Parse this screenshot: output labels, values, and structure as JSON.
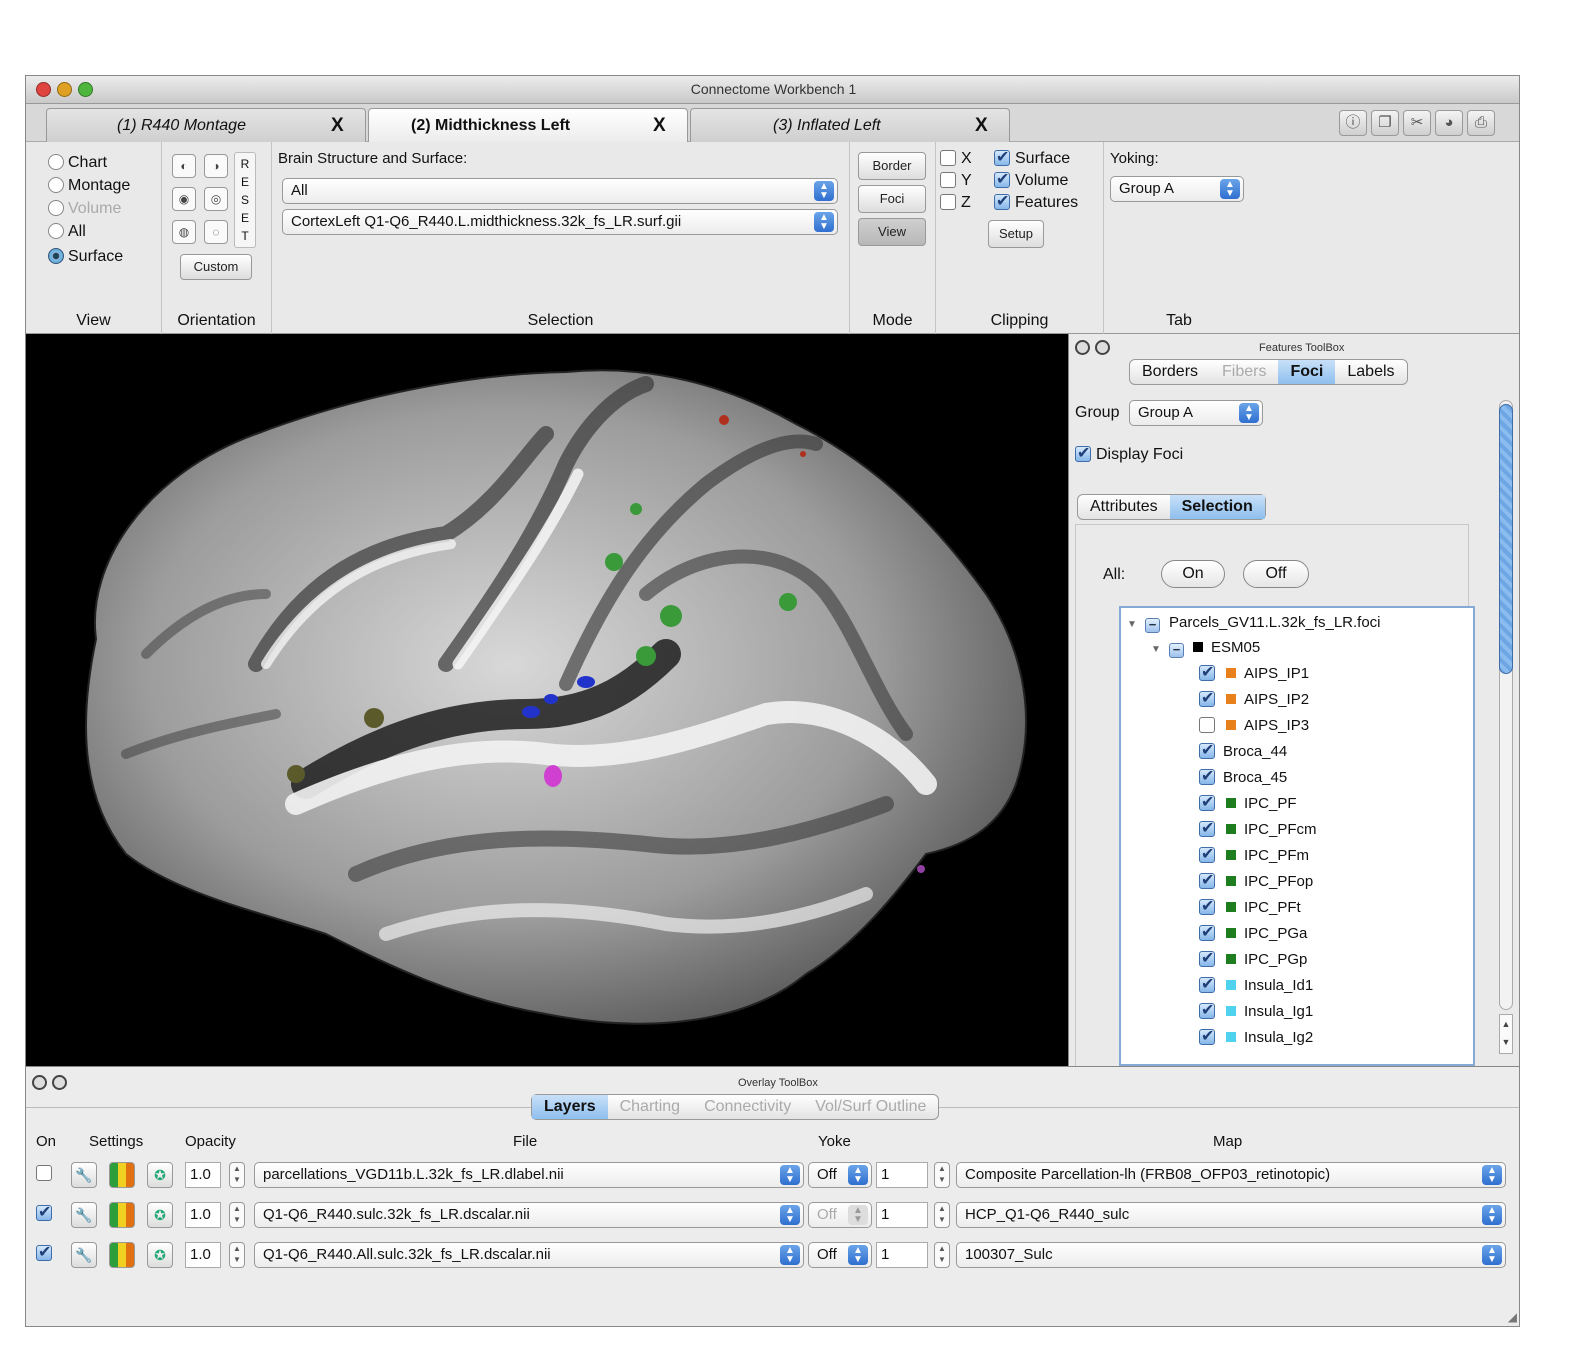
{
  "window": {
    "title": "Connectome Workbench 1"
  },
  "tabs": [
    {
      "label": "(1) R440 Montage",
      "close": "X"
    },
    {
      "label": "(2) Midthickness Left",
      "close": "X"
    },
    {
      "label": "(3) Inflated Left",
      "close": "X"
    }
  ],
  "ribbon": {
    "view": {
      "label": "View",
      "options": [
        "Chart",
        "Montage",
        "Volume",
        "All",
        "Surface"
      ],
      "selected": "Surface"
    },
    "orientation": {
      "label": "Orientation",
      "reset_letters": [
        "R",
        "E",
        "S",
        "E",
        "T"
      ],
      "custom_label": "Custom"
    },
    "selection": {
      "label": "Selection",
      "heading": "Brain Structure and Surface:",
      "structure": "All",
      "surface": "CortexLeft Q1-Q6_R440.L.midthickness.32k_fs_LR.surf.gii"
    },
    "mode": {
      "label": "Mode",
      "buttons": [
        "Border",
        "Foci",
        "View"
      ],
      "selected": "View"
    },
    "clipping": {
      "label": "Clipping",
      "axes": [
        {
          "name": "X",
          "checked": false
        },
        {
          "name": "Y",
          "checked": false
        },
        {
          "name": "Z",
          "checked": false
        }
      ],
      "types": [
        {
          "name": "Surface",
          "checked": true
        },
        {
          "name": "Volume",
          "checked": true
        },
        {
          "name": "Features",
          "checked": true
        }
      ],
      "setup_label": "Setup"
    },
    "tab": {
      "label": "Tab",
      "yoking_label": "Yoking:",
      "yoking_value": "Group A"
    }
  },
  "features_toolbox": {
    "title": "Features ToolBox",
    "tabs": [
      "Borders",
      "Fibers",
      "Foci",
      "Labels"
    ],
    "selected_tab": "Foci",
    "group_label": "Group",
    "group_value": "Group A",
    "display_foci_label": "Display Foci",
    "subtabs": [
      "Attributes",
      "Selection"
    ],
    "selected_subtab": "Selection",
    "all_label": "All:",
    "on_label": "On",
    "off_label": "Off",
    "tree": {
      "file": "Parcels_GV11.L.32k_fs_LR.foci",
      "class": "ESM05",
      "items": [
        {
          "name": "AIPS_IP1",
          "checked": true,
          "color": "#e8801c"
        },
        {
          "name": "AIPS_IP2",
          "checked": true,
          "color": "#e8801c"
        },
        {
          "name": "AIPS_IP3",
          "checked": false,
          "color": "#e8801c"
        },
        {
          "name": "Broca_44",
          "checked": true,
          "color": ""
        },
        {
          "name": "Broca_45",
          "checked": true,
          "color": ""
        },
        {
          "name": "IPC_PF",
          "checked": true,
          "color": "#1e7d1e"
        },
        {
          "name": "IPC_PFcm",
          "checked": true,
          "color": "#1e7d1e"
        },
        {
          "name": "IPC_PFm",
          "checked": true,
          "color": "#1e7d1e"
        },
        {
          "name": "IPC_PFop",
          "checked": true,
          "color": "#1e7d1e"
        },
        {
          "name": "IPC_PFt",
          "checked": true,
          "color": "#1e7d1e"
        },
        {
          "name": "IPC_PGa",
          "checked": true,
          "color": "#1e7d1e"
        },
        {
          "name": "IPC_PGp",
          "checked": true,
          "color": "#1e7d1e"
        },
        {
          "name": "Insula_Id1",
          "checked": true,
          "color": "#4fd2ee"
        },
        {
          "name": "Insula_Ig1",
          "checked": true,
          "color": "#4fd2ee"
        },
        {
          "name": "Insula_Ig2",
          "checked": true,
          "color": "#4fd2ee"
        }
      ]
    }
  },
  "overlay_toolbox": {
    "title": "Overlay ToolBox",
    "tabs": [
      "Layers",
      "Charting",
      "Connectivity",
      "Vol/Surf Outline"
    ],
    "selected_tab": "Layers",
    "headers": {
      "on": "On",
      "settings": "Settings",
      "opacity": "Opacity",
      "file": "File",
      "yoke": "Yoke",
      "map": "Map"
    },
    "rows": [
      {
        "on": false,
        "opacity": "1.0",
        "file": "parcellations_VGD11b.L.32k_fs_LR.dlabel.nii",
        "yoke": "Off",
        "yoke_enabled": true,
        "map_index": "1",
        "map": "Composite Parcellation-lh (FRB08_OFP03_retinotopic)"
      },
      {
        "on": true,
        "opacity": "1.0",
        "file": "Q1-Q6_R440.sulc.32k_fs_LR.dscalar.nii",
        "yoke": "Off",
        "yoke_enabled": false,
        "map_index": "1",
        "map": "HCP_Q1-Q6_R440_sulc"
      },
      {
        "on": true,
        "opacity": "1.0",
        "file": "Q1-Q6_R440.All.sulc.32k_fs_LR.dscalar.nii",
        "yoke": "Off",
        "yoke_enabled": true,
        "map_index": "1",
        "map": "100307_Sulc"
      }
    ]
  },
  "colors": {
    "viewport_bg": "#000000",
    "accent_blue": "#8ebfee",
    "foci_green": "#3a9a3a",
    "foci_blue": "#2233cc",
    "foci_magenta": "#d040d0",
    "foci_olive": "#5a5a2a"
  }
}
